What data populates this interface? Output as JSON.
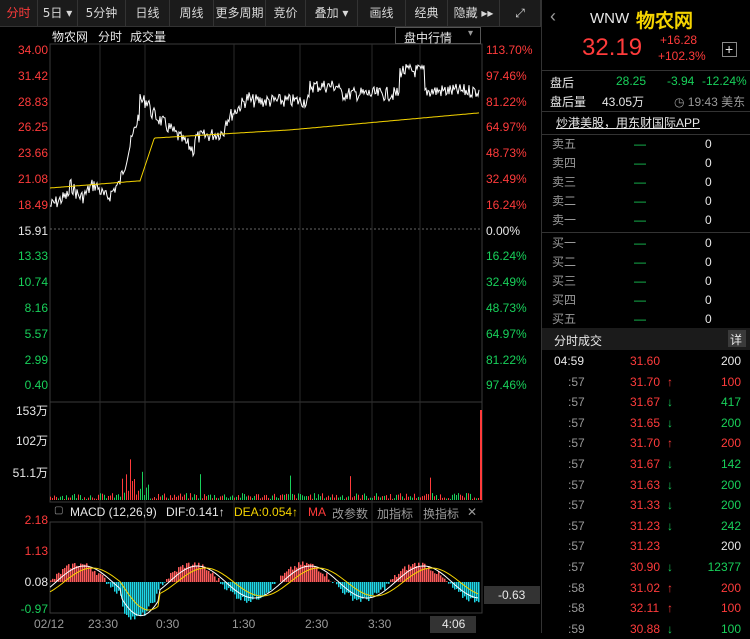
{
  "toolbar": {
    "items": [
      {
        "label": "分时",
        "w": 38,
        "active": true
      },
      {
        "label": "5日 ▾",
        "w": 40
      },
      {
        "label": "5分钟",
        "w": 48
      },
      {
        "label": "日线",
        "w": 44
      },
      {
        "label": "周线",
        "w": 44
      },
      {
        "label": "更多周期",
        "w": 52
      },
      {
        "label": "竞价",
        "w": 40
      },
      {
        "label": "叠加 ▾",
        "w": 52
      },
      {
        "label": "画线",
        "w": 48
      },
      {
        "label": "经典",
        "w": 42
      },
      {
        "label": "隐藏 ▸▸",
        "w": 52
      },
      {
        "label": "⤢",
        "w": 41
      }
    ]
  },
  "chart_header": {
    "stock": "物农网",
    "tab1": "分时",
    "tab2": "成交量",
    "dropdown": "盘中行情"
  },
  "price_axis": {
    "left": [
      "34.00",
      "31.42",
      "28.83",
      "26.25",
      "23.66",
      "21.08",
      "18.49",
      "15.91",
      "13.33",
      "10.74",
      "8.16",
      "5.57",
      "2.99",
      "0.40"
    ],
    "right": [
      "113.70%",
      "97.46%",
      "81.22%",
      "64.97%",
      "48.73%",
      "32.49%",
      "16.24%",
      "0.00%",
      "16.24%",
      "32.49%",
      "48.73%",
      "64.97%",
      "81.22%",
      "97.46%"
    ]
  },
  "volume_axis": [
    "153万",
    "102万",
    "51.1万"
  ],
  "macd": {
    "title": "MACD (12,26,9)",
    "dif": "DIF:0.141↑",
    "dea": "DEA:0.054↑",
    "ma": "MA",
    "params": "改参数",
    "add": "加指标",
    "swap": "换指标",
    "close": "✕",
    "axis": [
      "2.18",
      "1.13",
      "0.08",
      "-0.97"
    ],
    "cursor_value": "-0.63"
  },
  "time_axis": [
    "02/12",
    "23:30",
    "0:30",
    "1:30",
    "2:30",
    "3:30"
  ],
  "time_cursor": "4:06",
  "quote": {
    "back": "‹",
    "ticker": "WNW",
    "name": "物农网",
    "price": "32.19",
    "change": "+16.28",
    "pct": "+102.3%",
    "add": "+"
  },
  "after_hours": {
    "label": "盘后",
    "price": "28.25",
    "chg": "-3.94",
    "pct": "-12.24%",
    "vol_label": "盘后量",
    "vol": "43.05万",
    "time": "◷ 19:43 美东"
  },
  "banner": "炒港美股，用东财国际APP",
  "order_book": {
    "asks": [
      {
        "label": "卖五",
        "price": "—",
        "vol": "0"
      },
      {
        "label": "卖四",
        "price": "—",
        "vol": "0"
      },
      {
        "label": "卖三",
        "price": "—",
        "vol": "0"
      },
      {
        "label": "卖二",
        "price": "—",
        "vol": "0"
      },
      {
        "label": "卖一",
        "price": "—",
        "vol": "0"
      }
    ],
    "bids": [
      {
        "label": "买一",
        "price": "—",
        "vol": "0"
      },
      {
        "label": "买二",
        "price": "—",
        "vol": "0"
      },
      {
        "label": "买三",
        "price": "—",
        "vol": "0"
      },
      {
        "label": "买四",
        "price": "—",
        "vol": "0"
      },
      {
        "label": "买五",
        "price": "—",
        "vol": "0"
      }
    ]
  },
  "trades_header": {
    "title": "分时成交",
    "detail": "详"
  },
  "trades": [
    {
      "time": "04:59",
      "price": "31.60",
      "arrow": "",
      "vol": "200",
      "dir": "none"
    },
    {
      "time": ":57",
      "price": "31.70",
      "arrow": "↑",
      "vol": "100",
      "dir": "up"
    },
    {
      "time": ":57",
      "price": "31.67",
      "arrow": "↓",
      "vol": "417",
      "dir": "down"
    },
    {
      "time": ":57",
      "price": "31.65",
      "arrow": "↓",
      "vol": "200",
      "dir": "down"
    },
    {
      "time": ":57",
      "price": "31.70",
      "arrow": "↑",
      "vol": "200",
      "dir": "up"
    },
    {
      "time": ":57",
      "price": "31.67",
      "arrow": "↓",
      "vol": "142",
      "dir": "down"
    },
    {
      "time": ":57",
      "price": "31.63",
      "arrow": "↓",
      "vol": "200",
      "dir": "down"
    },
    {
      "time": ":57",
      "price": "31.33",
      "arrow": "↓",
      "vol": "200",
      "dir": "down"
    },
    {
      "time": ":57",
      "price": "31.23",
      "arrow": "↓",
      "vol": "242",
      "dir": "down"
    },
    {
      "time": ":57",
      "price": "31.23",
      "arrow": "",
      "vol": "200",
      "dir": "none"
    },
    {
      "time": ":57",
      "price": "30.90",
      "arrow": "↓",
      "vol": "12377",
      "dir": "down"
    },
    {
      "time": ":58",
      "price": "31.02",
      "arrow": "↑",
      "vol": "200",
      "dir": "up"
    },
    {
      "time": ":58",
      "price": "32.11",
      "arrow": "↑",
      "vol": "100",
      "dir": "up"
    },
    {
      "time": ":59",
      "price": "30.88",
      "arrow": "↓",
      "vol": "100",
      "dir": "down"
    }
  ],
  "colors": {
    "up": "#ff3b3b",
    "down": "#18d05a",
    "avg": "#f5d400",
    "price_line": "#ffffff",
    "macd_up": "#ff5b5b",
    "macd_down": "#1ed6e6"
  }
}
